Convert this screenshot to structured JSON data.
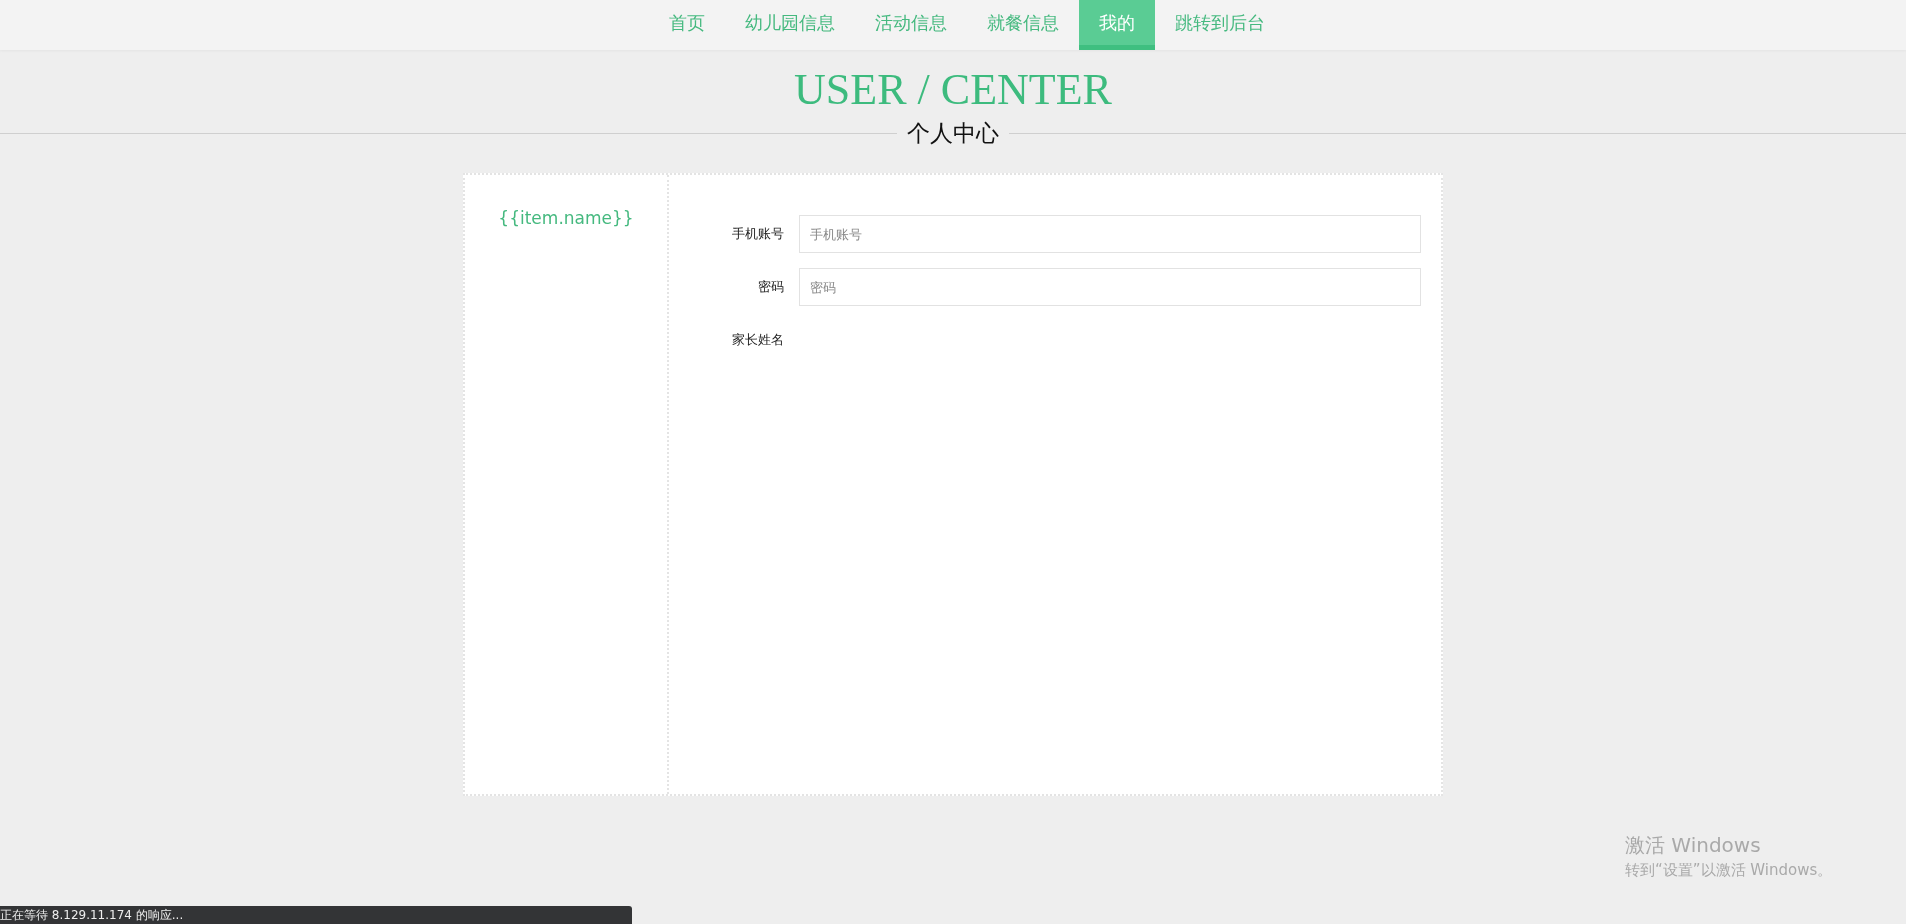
{
  "nav": {
    "items": [
      {
        "label": "首页",
        "selected": false
      },
      {
        "label": "幼儿园信息",
        "selected": false
      },
      {
        "label": "活动信息",
        "selected": false
      },
      {
        "label": "就餐信息",
        "selected": false
      },
      {
        "label": "我的",
        "selected": true
      },
      {
        "label": "跳转到后台",
        "selected": false
      }
    ]
  },
  "heading": {
    "title": "USER / CENTER",
    "subtitle": "个人中心"
  },
  "sidebar": {
    "items": [
      "{{item.name}}"
    ]
  },
  "form": {
    "fields": [
      {
        "kind": "input",
        "label": "手机账号",
        "placeholder": "手机账号"
      },
      {
        "kind": "input",
        "label": "密码",
        "placeholder": "密码"
      },
      {
        "kind": "text",
        "label": "家长姓名"
      }
    ]
  },
  "activation": {
    "title": "激活 Windows",
    "hint": "转到“设置”以激活 Windows。"
  },
  "status_bar": "正在等待 8.129.11.174 的响应..."
}
